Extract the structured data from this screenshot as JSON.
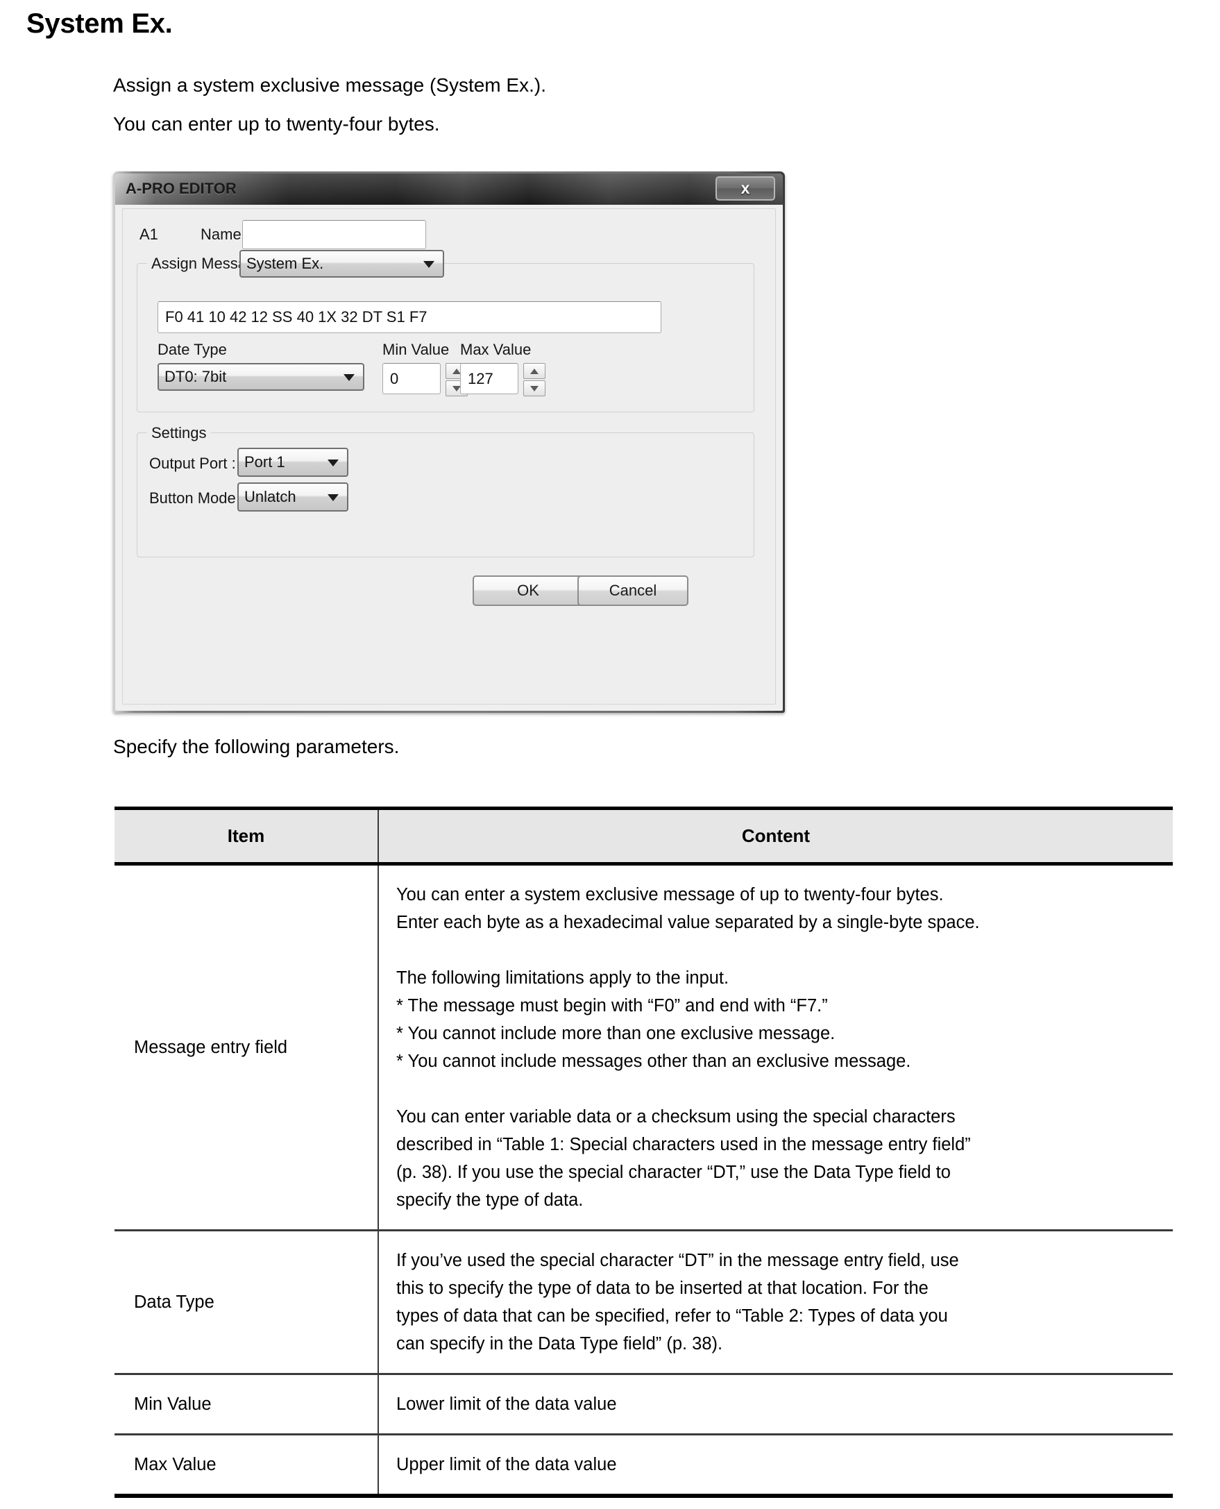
{
  "page": {
    "title": "System Ex.",
    "intro": "Assign a system exclusive message (System Ex.).\nYou can enter up to twenty-four bytes.",
    "caption": "Specify the following parameters."
  },
  "dialog": {
    "titlebar": "A-PRO EDITOR",
    "close_icon": "close-icon",
    "close_label": "x",
    "slot_label": "A1",
    "name_label": "Name :",
    "name_value": "",
    "assign_message_label": "Assign Message :",
    "assign_message_value": "System Ex.",
    "message_value": "F0 41 10 42 12 SS 40 1X 32 DT S1 F7",
    "date_type_label": "Date Type",
    "date_type_value": "DT0: 7bit",
    "min_value_label": "Min Value",
    "min_value": "0",
    "max_value_label": "Max Value",
    "max_value": "127",
    "settings_group": "Settings",
    "output_port_label": "Output Port :",
    "output_port_value": "Port 1",
    "button_mode_label": "Button Mode :",
    "button_mode_value": "Unlatch",
    "ok_label": "OK",
    "cancel_label": "Cancel"
  },
  "table": {
    "headers": [
      "Item",
      "Content"
    ],
    "rows": [
      {
        "item": "Message entry field",
        "content": "You can enter a system exclusive message of up to twenty-four bytes.\nEnter each byte as a hexadecimal value separated by a single-byte space.\n\nThe following limitations apply to the input.\n*  The message must begin with “F0” and end with “F7.”\n*  You cannot include more than one exclusive message.\n*  You cannot include messages other than an exclusive message.\n\nYou can enter variable data or a checksum using the special characters\ndescribed in  “Table 1: Special characters used in the message entry field”\n(p. 38). If you use the special character “DT,” use the Data Type field to\nspecify the type of data."
      },
      {
        "item": "Data Type",
        "content": "If you’ve used the special character “DT” in the message entry field, use\nthis to specify the type of data to be inserted at that location. For the\ntypes of data that can be specified, refer to  “Table 2: Types of data you\ncan specify in the Data Type field” (p. 38)."
      },
      {
        "item": "Min Value",
        "content": "Lower limit of the data value"
      },
      {
        "item": "Max Value",
        "content": "Upper limit of the data value"
      }
    ]
  }
}
